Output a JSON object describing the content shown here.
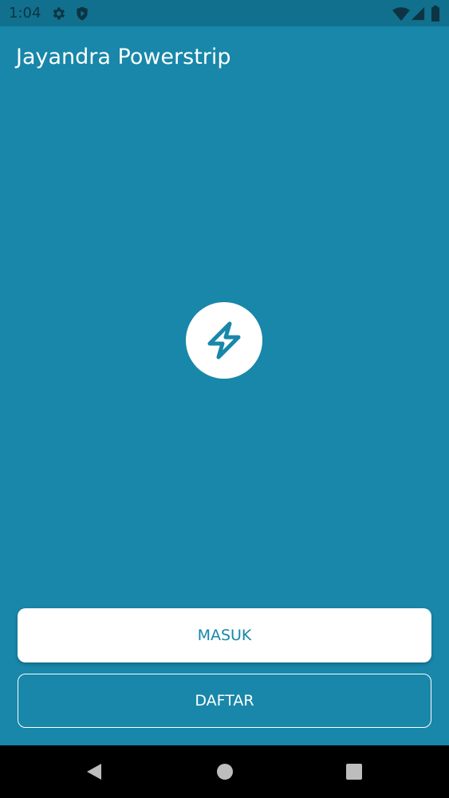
{
  "status_bar": {
    "time": "1:04",
    "icons": [
      "settings-icon",
      "shield-play-icon",
      "wifi-icon",
      "signal-icon",
      "battery-icon"
    ]
  },
  "app": {
    "title": "Jayandra Powerstrip",
    "logo_icon": "lightning-bolt-icon"
  },
  "buttons": {
    "login_label": "MASUK",
    "register_label": "DAFTAR"
  },
  "nav_bar": {
    "icons": [
      "back-icon",
      "home-icon",
      "recents-icon"
    ]
  },
  "colors": {
    "background": "#1887a9",
    "status_bar": "#10708e",
    "button_primary_bg": "#ffffff",
    "button_primary_text": "#1887a9",
    "nav_bar": "#000000"
  }
}
